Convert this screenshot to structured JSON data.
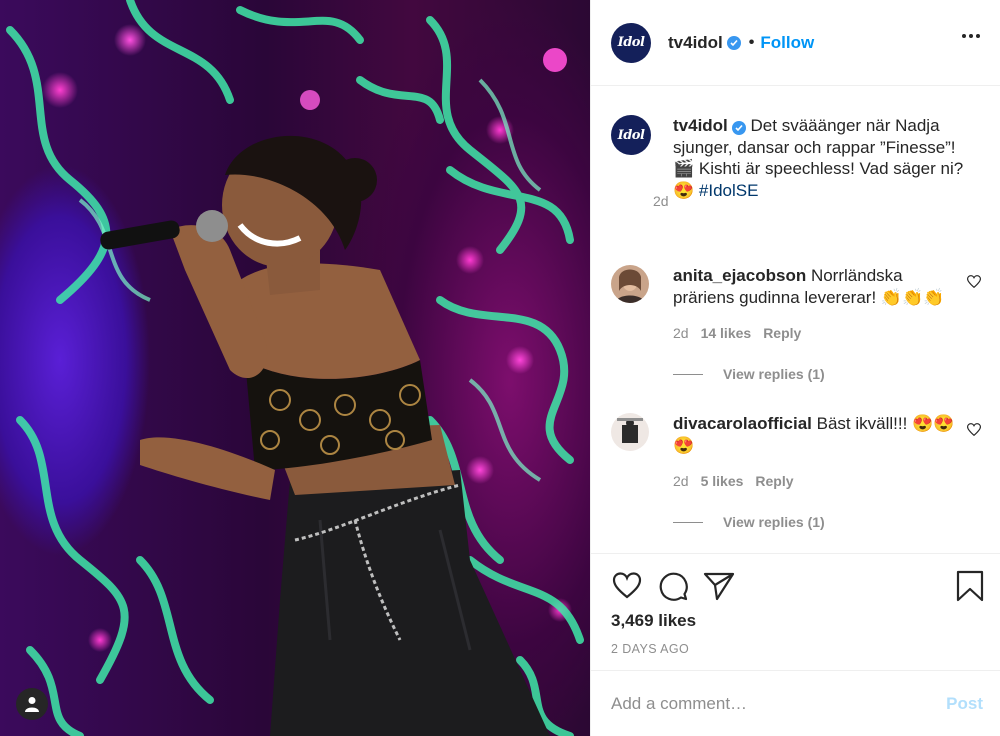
{
  "photo": {
    "alt_icon": "user-circle-icon"
  },
  "header": {
    "logo_text": "Idol",
    "username": "tv4idol",
    "separator": "•",
    "follow_label": "Follow",
    "more_icon": "more-horizontal-icon"
  },
  "caption": {
    "username": "tv4idol",
    "text_line1": "Det svääänger när Nadja sjunger, dansar och rappar ”Finesse”!",
    "text_line2": "Kishti är speechless! Vad säger ni?",
    "hashtag": "#IdolSE",
    "time": "2d"
  },
  "comments": [
    {
      "username": "anita_ejacobson",
      "text": "Norrländska präriens gudinna levererar! 👏👏👏",
      "time": "2d",
      "likes": "14 likes",
      "reply_label": "Reply",
      "view_replies": "View replies (1)"
    },
    {
      "username": "divacarolaofficial",
      "text": "Bäst ikväll!!! 😍😍😍",
      "time": "2d",
      "likes": "5 likes",
      "reply_label": "Reply",
      "view_replies": "View replies (1)"
    }
  ],
  "actions": {
    "icons": [
      "heart-icon",
      "comment-icon",
      "share-icon",
      "bookmark-icon"
    ],
    "likes": "3,469 likes",
    "date": "2 DAYS AGO"
  },
  "add_comment": {
    "placeholder": "Add a comment…",
    "post_label": "Post"
  },
  "colors": {
    "accent": "#0095f6",
    "verified": "#3897f0",
    "muted": "#8e8e8e",
    "post_disabled": "#b2dffc",
    "hashtag": "#00376b"
  }
}
